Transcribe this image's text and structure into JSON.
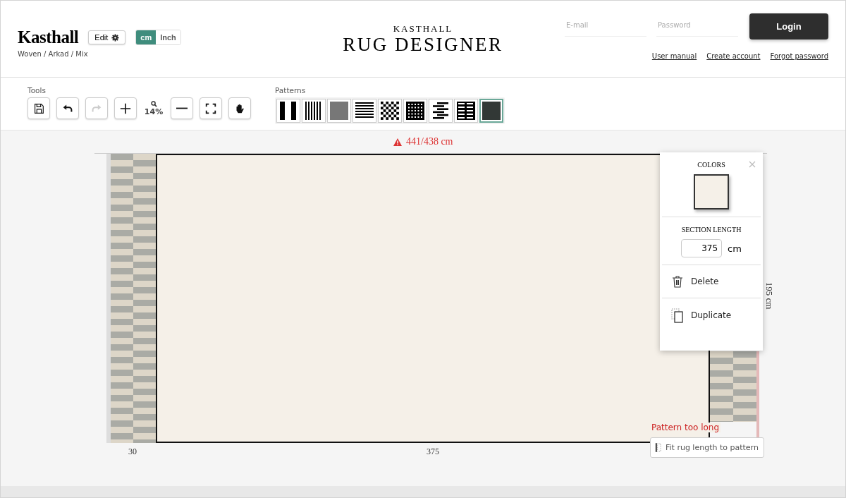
{
  "header": {
    "brand": "Kasthall",
    "edit_button": "Edit",
    "units": [
      {
        "label": "cm",
        "selected": true
      },
      {
        "label": "Inch",
        "selected": false
      }
    ],
    "breadcrumb": "Woven / Arkad / Mix",
    "logo_top": "KASTHALL",
    "logo_main": "RUG DESIGNER",
    "email": {
      "placeholder": "E-mail"
    },
    "password": {
      "placeholder": "Password"
    },
    "login_button": "Login",
    "links": [
      "User manual",
      "Create account",
      "Forgot password"
    ]
  },
  "toolbar": {
    "tools_label": "Tools",
    "zoom_level": "14%",
    "tools": [
      {
        "kind": "save",
        "disabled": false
      },
      {
        "kind": "undo",
        "disabled": false
      },
      {
        "kind": "redo",
        "disabled": true
      },
      {
        "kind": "zoom-in",
        "disabled": false
      },
      {
        "kind": "zoom-out",
        "disabled": false
      },
      {
        "kind": "fit",
        "disabled": false
      },
      {
        "kind": "pan",
        "disabled": false
      }
    ],
    "patterns_label": "Patterns",
    "patterns": [
      {
        "kind": "wide-stripes",
        "selected": false
      },
      {
        "kind": "thin-stripes",
        "selected": false
      },
      {
        "kind": "dots",
        "selected": false
      },
      {
        "kind": "horizontal",
        "selected": false
      },
      {
        "kind": "checker",
        "selected": false
      },
      {
        "kind": "grid",
        "selected": false
      },
      {
        "kind": "offset",
        "selected": false
      },
      {
        "kind": "bricks",
        "selected": false
      },
      {
        "kind": "solid",
        "selected": true
      }
    ]
  },
  "canvas": {
    "length_warning": "441/438 cm",
    "width_label": "195 cm",
    "section_labels": [
      "30",
      "375"
    ],
    "error": "Pattern too long",
    "fit_button": "Fit rug length to pattern"
  },
  "section_panel": {
    "colors_heading": "COLORS",
    "length_heading": "SECTION LENGTH",
    "length_value": "375",
    "length_unit": "cm",
    "actions": [
      {
        "kind": "delete",
        "label": "Delete"
      },
      {
        "kind": "duplicate",
        "label": "Duplicate"
      }
    ]
  }
}
